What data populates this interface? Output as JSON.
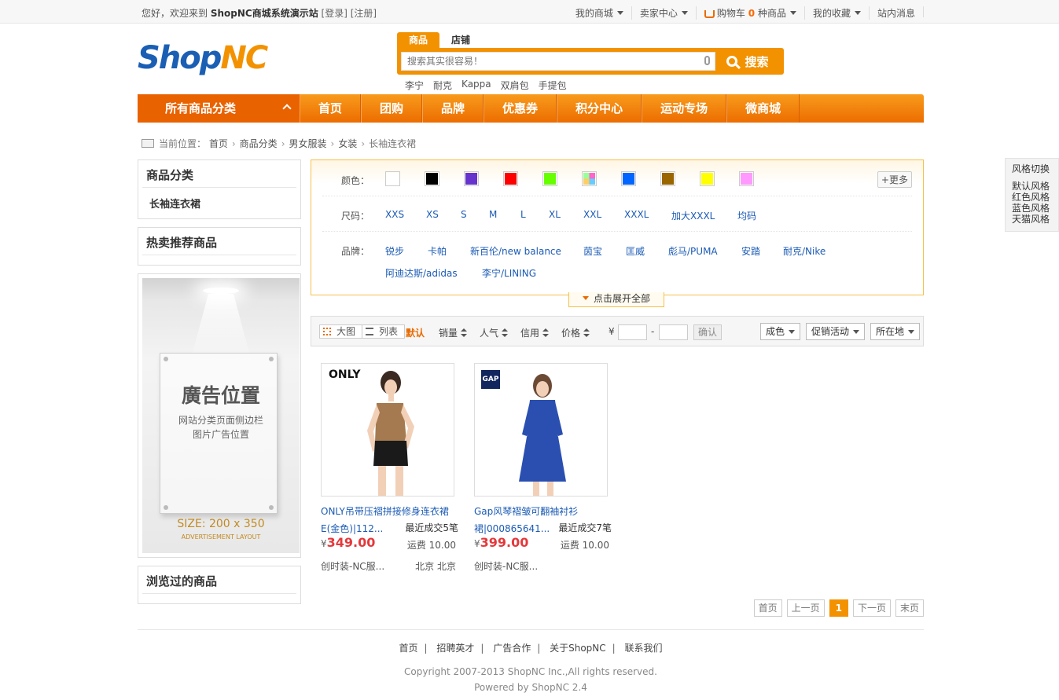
{
  "topbar": {
    "welcome": "您好，欢迎来到 ",
    "site": "ShopNC商城系统演示站",
    "login": "[登录]",
    "register": "[注册]",
    "menus": [
      "我的商城",
      "卖家中心"
    ],
    "cart_label": "购物车",
    "cart_count": "0",
    "cart_suffix": "种商品",
    "fav": "我的收藏",
    "msg": "站内消息"
  },
  "logo": {
    "shop": "Shop",
    "nc": "NC"
  },
  "search": {
    "tab_goods": "商品",
    "tab_store": "店铺",
    "placeholder": "搜索其实很容易！",
    "button": "搜索",
    "hot": [
      "李宁",
      "耐克",
      "Kappa",
      "双肩包",
      "手提包"
    ]
  },
  "nav": {
    "all": "所有商品分类",
    "items": [
      "首页",
      "团购",
      "品牌",
      "优惠券",
      "积分中心",
      "运动专场",
      "微商城"
    ]
  },
  "breadcrumb": {
    "label": "当前位置：",
    "items": [
      "首页",
      "商品分类",
      "男女服装",
      "女装"
    ],
    "current": "长袖连衣裙"
  },
  "sidebar": {
    "cat_title": "商品分类",
    "cat_item": "长袖连衣裙",
    "hot_title": "热卖推荐商品",
    "ad_title": "廣告位置",
    "ad_line1": "网站分类页面侧边栏",
    "ad_line2": "图片广告位置",
    "ad_size": "SIZE: 200 x 350",
    "ad_layout": "ADVERTISEMENT LAYOUT",
    "viewed_title": "浏览过的商品"
  },
  "filter": {
    "color_label": "颜色：",
    "colors": [
      "#ffffff",
      "#000000",
      "#6633cc",
      "#ff0000",
      "#66ff00",
      "mixed",
      "#0066ff",
      "#996600",
      "#ffff00",
      "#ff99ff"
    ],
    "more": "更多",
    "size_label": "尺码：",
    "sizes": [
      "XXS",
      "XS",
      "S",
      "M",
      "L",
      "XL",
      "XXL",
      "XXXL",
      "加大XXXL",
      "均码"
    ],
    "brand_label": "品牌：",
    "brands_row1": [
      "锐步",
      "卡帕",
      "新百伦/new balance",
      "茵宝",
      "匡威",
      "彪马/PUMA",
      "安踏",
      "耐克/Nike"
    ],
    "brands_row2": [
      "阿迪达斯/adidas",
      "李宁/LINING"
    ],
    "expand": "点击展开全部"
  },
  "sortbar": {
    "big": "大图",
    "list": "列表",
    "default": "默认",
    "sorts": [
      "销量",
      "人气",
      "信用",
      "价格"
    ],
    "yen": "¥",
    "dash": "-",
    "ok": "确认",
    "dd": [
      "成色",
      "促销活动",
      "所在地"
    ]
  },
  "products": [
    {
      "brand": "ONLY",
      "name": "ONLY吊带压褶拼接修身连衣裙E(金色)|112...",
      "deal": "最近成交5笔",
      "yen": "¥",
      "price": "349.00",
      "ship": "运费 10.00",
      "store": "创时装-NC服...",
      "loc": "北京 北京"
    },
    {
      "brand": "GAP",
      "name": "Gap风琴褶皱可翻袖衬衫裙|000865641...",
      "deal": "最近成交7笔",
      "yen": "¥",
      "price": "399.00",
      "ship": "运费 10.00",
      "store": "创时装-NC服...",
      "loc": ""
    }
  ],
  "pager": [
    "首页",
    "上一页",
    "1",
    "下一页",
    "末页"
  ],
  "footer": {
    "links": [
      "首页",
      "招聘英才",
      "广告合作",
      "关于ShopNC",
      "联系我们"
    ],
    "copy": "Copyright 2007-2013 ShopNC Inc.,All rights reserved.",
    "powered": "Powered by ShopNC 2.4"
  },
  "styles": {
    "title": "风格切换",
    "items": [
      "默认风格",
      "红色风格",
      "蓝色风格",
      "天猫风格"
    ]
  },
  "colors": {
    "accent": "#f39200",
    "link": "#1b5bb5",
    "price": "#e4393c"
  }
}
